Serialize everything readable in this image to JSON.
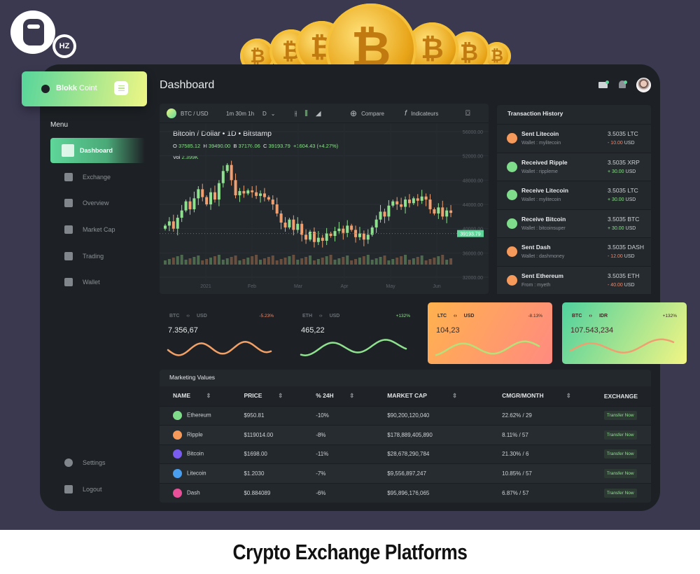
{
  "brand": {
    "logo_text": "9 HZ",
    "app_name_bold": "Blokk",
    "app_name_light": "Coint"
  },
  "caption": "Crypto Exchange Platforms",
  "header": {
    "title": "Dashboard"
  },
  "sidebar": {
    "menu_label": "Menu",
    "items": [
      {
        "label": "Dashboard",
        "active": true
      },
      {
        "label": "Exchange"
      },
      {
        "label": "Overview"
      },
      {
        "label": "Market Cap"
      },
      {
        "label": "Trading"
      },
      {
        "label": "Wallet"
      }
    ],
    "bottom": [
      {
        "label": "Settings"
      },
      {
        "label": "Logout"
      }
    ]
  },
  "toolbar": {
    "pair": "BTC / USD",
    "intervals": "1m 30m 1h",
    "interval_selected": "D",
    "compare": "Compare",
    "indicators": "Indicateurs"
  },
  "chart_data": {
    "type": "candlestick",
    "title": "Bitcoin / Dollar • 1D • Bitstamp",
    "ohlc": {
      "o_label": "O",
      "o": "37585.12",
      "h_label": "H",
      "h": "39490.00",
      "b_label": "B",
      "b": "37176.06",
      "c_label": "C",
      "c": "39193.79",
      "change": "+1604.43 (+4.27%)"
    },
    "vol_label": "Vol",
    "vol": "2.399K",
    "last_price": "39193.79",
    "y_ticks": [
      "56000.00",
      "52000.00",
      "48000.00",
      "44000.00",
      "40000.00",
      "36000.00",
      "32000.00"
    ],
    "ylim": [
      32000,
      56000
    ],
    "x_ticks": [
      "2021",
      "Feb",
      "Mar",
      "Apr",
      "May",
      "Jun"
    ],
    "closes": [
      40500,
      41200,
      40000,
      41800,
      43000,
      44500,
      43200,
      45000,
      46500,
      45200,
      44000,
      46000,
      44800,
      47500,
      49500,
      50500,
      48000,
      45500,
      46200,
      45800,
      46300,
      46000,
      45400,
      45800,
      45200,
      44800,
      44000,
      42500,
      41000,
      40200,
      41500,
      39800,
      40800,
      39000,
      38200,
      39500,
      37800,
      38500,
      38000,
      39200,
      38800,
      39600,
      40000,
      39300,
      40500,
      39800,
      38600,
      39200,
      38200,
      39000,
      40200,
      41500,
      42800,
      42000,
      43800,
      44500,
      44000,
      43600,
      44800,
      44200,
      45000,
      44600,
      45300,
      44800,
      43200,
      42500,
      43500,
      42000,
      43000,
      42600
    ]
  },
  "transactions": {
    "title": "Transaction History",
    "items": [
      {
        "title": "Sent Litecoin",
        "sub": "Wallet : mylitecoin",
        "amount": "3.5035 LTC",
        "usd_sign": "-",
        "usd": "10.00",
        "usd_unit": "USD",
        "type": "sent",
        "color": "#f59a5a"
      },
      {
        "title": "Received Ripple",
        "sub": "Wallet : rippleme",
        "amount": "3.5035 XRP",
        "usd_sign": "+",
        "usd": "30.00",
        "usd_unit": "USD",
        "type": "received",
        "color": "#7fdc8a"
      },
      {
        "title": "Receive Litecoin",
        "sub": "Wallet : mylitecoin",
        "amount": "3.5035 LTC",
        "usd_sign": "+",
        "usd": "30.00",
        "usd_unit": "USD",
        "type": "received",
        "color": "#7fdc8a"
      },
      {
        "title": "Receive Bitcoin",
        "sub": "Wallet : bitcoinsuper",
        "amount": "3.5035 BTC",
        "usd_sign": "+",
        "usd": "30.00",
        "usd_unit": "USD",
        "type": "received",
        "color": "#7fdc8a"
      },
      {
        "title": "Sent Dash",
        "sub": "Wallet : dashmoney",
        "amount": "3.5035 DASH",
        "usd_sign": "-",
        "usd": "12.00",
        "usd_unit": "USD",
        "type": "sent",
        "color": "#f59a5a"
      },
      {
        "title": "Sent Ethereum",
        "sub": "From : myeth",
        "amount": "3.5035 ETH",
        "usd_sign": "-",
        "usd": "40.00",
        "usd_unit": "USD",
        "type": "sent",
        "color": "#f59a5a"
      }
    ]
  },
  "tickers": [
    {
      "from": "BTC",
      "to": "USD",
      "change": "-5.23%",
      "value": "7.356,67"
    },
    {
      "from": "ETH",
      "to": "USD",
      "change": "+132%",
      "value": "465,22"
    },
    {
      "from": "LTC",
      "to": "USD",
      "change": "-8.13%",
      "value": "104,23"
    },
    {
      "from": "BTC",
      "to": "IDR",
      "change": "+132%",
      "value": "107.543,234"
    }
  ],
  "market": {
    "title": "Marketing Values",
    "columns": [
      "NAME",
      "PRICE",
      "% 24H",
      "MARKET CAP",
      "CMGR/MONTH",
      "EXCHANGE"
    ],
    "rows": [
      {
        "name": "Ethereum",
        "price": "$950.81",
        "change": "-10%",
        "cap": "$90,200,120,040",
        "cmgr": "22.62% / 29",
        "action": "Transfer Now",
        "color": "#7fdc8a"
      },
      {
        "name": "Ripple",
        "price": "$119014.00",
        "change": "-8%",
        "cap": "$178,889,405,890",
        "cmgr": "8.11% / 57",
        "action": "Transfer Now",
        "color": "#f59a5a"
      },
      {
        "name": "Bitcoin",
        "price": "$1698.00",
        "change": "-11%",
        "cap": "$28,678,290,784",
        "cmgr": "21.30% / 6",
        "action": "Transfer Now",
        "color": "#7a5cf0"
      },
      {
        "name": "Litecoin",
        "price": "$1.2030",
        "change": "-7%",
        "cap": "$9,556,897,247",
        "cmgr": "10.85% / 57",
        "action": "Transfer Now",
        "color": "#4a9ef0"
      },
      {
        "name": "Dash",
        "price": "$0.884089",
        "change": "-6%",
        "cap": "$95,896,176,065",
        "cmgr": "6.87% / 57",
        "action": "Transfer Now",
        "color": "#e8509a"
      }
    ]
  },
  "colors": {
    "up": "#8fe08f",
    "down": "#f0a070",
    "accent_green": "#5ed69a",
    "accent_yellow": "#eef584"
  }
}
